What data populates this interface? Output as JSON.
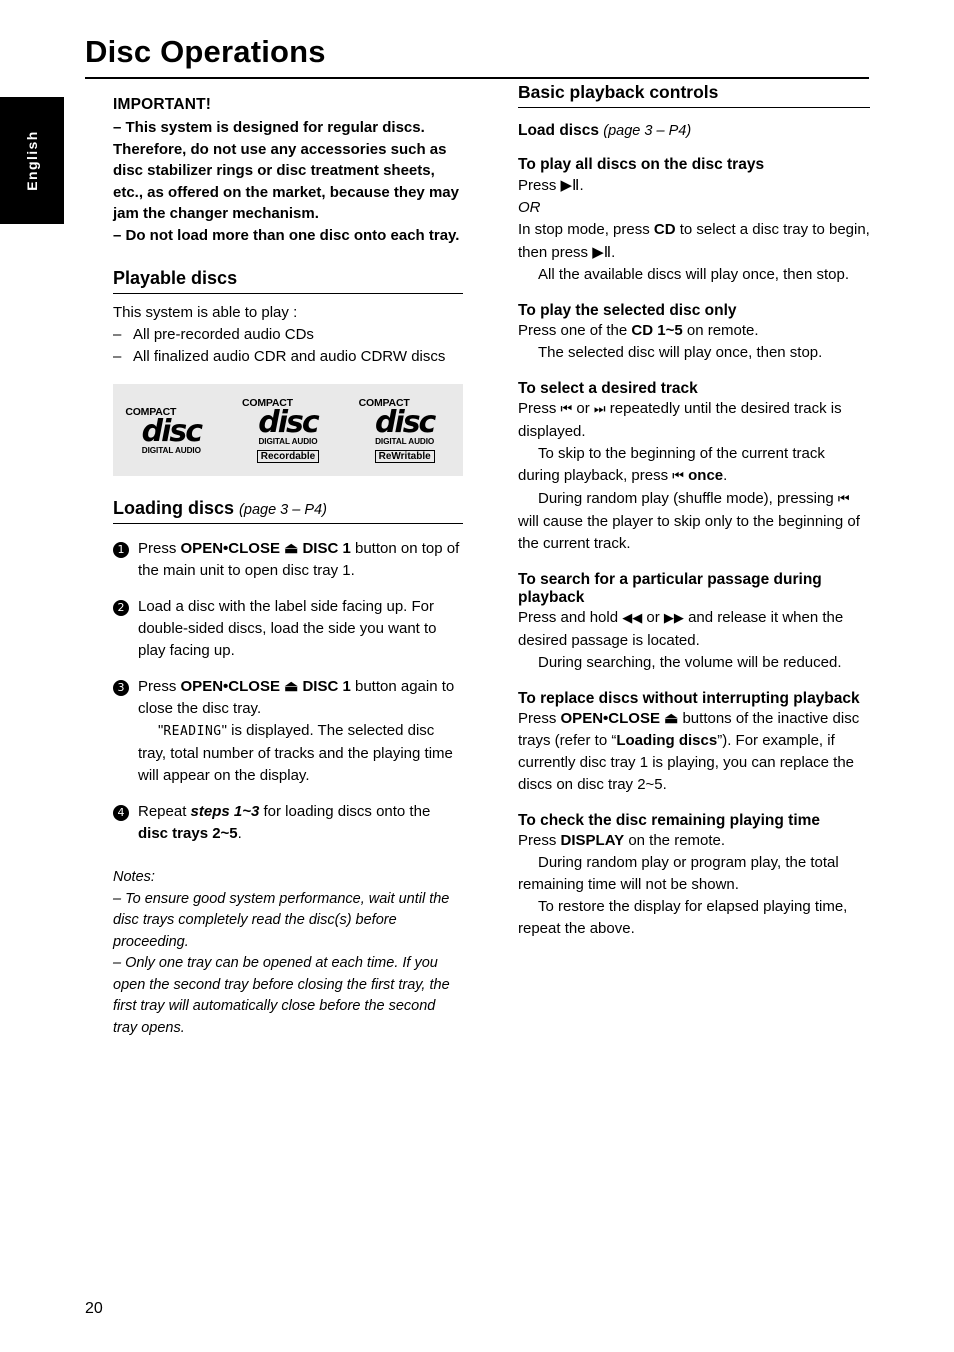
{
  "page": {
    "title": "Disc Operations",
    "language_tab": "English",
    "page_number": "20"
  },
  "left": {
    "important": {
      "heading": "IMPORTANT!",
      "line1": "–  This system is designed for regular discs.  Therefore, do not use any accessories such as disc stabilizer rings or disc treatment sheets, etc., as offered on the market, because they may jam the changer mechanism.",
      "line2": "–  Do not load more than one disc onto each tray."
    },
    "playable": {
      "heading": "Playable discs",
      "intro": "This system is able to play :",
      "items": [
        "All pre-recorded audio CDs",
        "All finalized audio CDR and audio CDRW discs"
      ],
      "logos": [
        {
          "top": "COMPACT",
          "disc": "disc",
          "bottom": "DIGITAL AUDIO",
          "tag": ""
        },
        {
          "top": "COMPACT",
          "disc": "disc",
          "bottom": "DIGITAL AUDIO",
          "tag": "Recordable"
        },
        {
          "top": "COMPACT",
          "disc": "disc",
          "bottom": "DIGITAL AUDIO",
          "tag": "ReWritable"
        }
      ]
    },
    "loading": {
      "heading": "Loading discs",
      "heading_sub": "(page 3 – P4)",
      "steps": [
        {
          "num": "1",
          "pre": "Press ",
          "bold": "OPEN•CLOSE ⏏ DISC 1",
          "post": " button on top of the main unit to open disc tray 1."
        },
        {
          "num": "2",
          "pre": "",
          "bold": "",
          "post": "Load a disc with the label side facing up. For double-sided discs, load the side you want to play facing up."
        },
        {
          "num": "3",
          "pre": "Press ",
          "bold": "OPEN•CLOSE ⏏ DISC 1",
          "post": " button again to close the disc tray.",
          "extra_quote_open": "\"",
          "extra_mono": "READING",
          "extra_quote_close": "\"",
          "extra": " is displayed. The selected disc tray, total number of tracks and the playing time will appear on the display."
        },
        {
          "num": "4",
          "pre": "Repeat ",
          "bold": "steps 1~3",
          "post": " for loading discs onto the ",
          "bold2": "disc trays 2~5",
          "post2": "."
        }
      ],
      "notes_label": "Notes:",
      "note1": "–  To ensure good system performance, wait until the disc trays completely read the disc(s) before proceeding.",
      "note2": "–  Only one tray can be opened at each time.  If you open the second tray before closing the first tray, the first tray will automatically close before the second tray opens."
    }
  },
  "right": {
    "heading": "Basic playback controls",
    "load_discs": {
      "label": "Load discs",
      "ref": "(page 3 – P4)"
    },
    "play_all": {
      "heading": "To play all discs on the disc trays",
      "line1_pre": "Press ",
      "line1_glyph": "▶Ⅱ",
      "or": "OR",
      "line2_pre": "In stop mode, press ",
      "line2_bold": "CD",
      "line2_mid": " to select a disc tray to begin, then press ",
      "line2_glyph": "▶Ⅱ",
      "line2_end": ".",
      "line3": "All the available discs will play once, then stop."
    },
    "play_selected": {
      "heading": "To play the selected disc only",
      "line1_pre": "Press one of the ",
      "line1_bold": "CD 1~5",
      "line1_post": " on remote.",
      "line2": "The selected disc will play once, then stop."
    },
    "select_track": {
      "heading": "To select a desired track",
      "line1_pre": "Press ",
      "glyph_prev": "⏮",
      "line1_mid": " or ",
      "glyph_next": "⏭",
      "line1_post": " repeatedly until the desired track is displayed.",
      "line2_pre": "To skip to the beginning of the current track during playback, press ",
      "line2_bold": "once",
      "line2_post": ".",
      "line3_pre": "During random play (shuffle mode), pressing ",
      "line3_post": " will cause the player to skip only to the beginning of the current track."
    },
    "search": {
      "heading": "To search for a particular passage during playback",
      "line1_pre": "Press and hold ",
      "glyph_rew": "◀◀",
      "line1_mid": " or ",
      "glyph_ff": "▶▶",
      "line1_post": " and release it when the desired passage is located.",
      "line2": "During searching, the volume will be reduced."
    },
    "replace": {
      "heading": "To replace discs without interrupting playback",
      "line1_pre": "Press ",
      "line1_bold": "OPEN•CLOSE ⏏",
      "line1_mid": " buttons of the inactive disc trays (refer to “",
      "line1_bold2": "Loading discs",
      "line1_post": "”). For example, if currently disc tray 1 is playing, you can replace the discs on disc tray 2~5."
    },
    "remaining": {
      "heading": "To check the disc remaining playing time",
      "line1_pre": "Press ",
      "line1_bold": "DISPLAY",
      "line1_post": " on the remote.",
      "line2": "During random play or program play, the total remaining time will not be shown.",
      "line3": "To restore the display for elapsed playing time, repeat the above."
    }
  }
}
